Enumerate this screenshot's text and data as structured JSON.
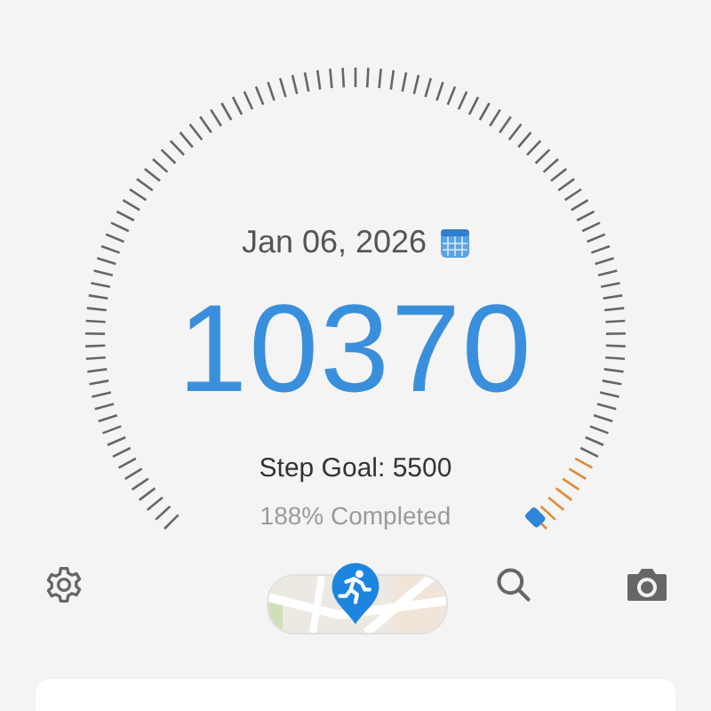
{
  "gauge": {
    "date": "Jan 06, 2026",
    "steps": "10370",
    "goal": "Step Goal: 5500",
    "completed": "188% Completed"
  },
  "toolbar": [
    {
      "kind": "settings"
    },
    {
      "kind": "map"
    },
    {
      "kind": "search"
    },
    {
      "kind": "camera"
    }
  ]
}
